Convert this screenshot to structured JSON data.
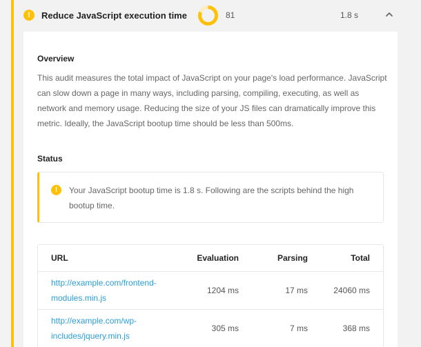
{
  "audit": {
    "title": "Reduce JavaScript execution time",
    "score": "81",
    "score_fraction": 0.81,
    "time": "1.8 s",
    "accent_color": "#ffc107",
    "warning_icon": "exclamation-icon",
    "toggle_icon": "chevron-up-icon"
  },
  "overview": {
    "heading": "Overview",
    "text": "This audit measures the total impact of JavaScript on your page's load performance. JavaScript can slow down a page in many ways, including parsing, compiling, executing, as well as network and memory usage. Reducing the size of your JS files can dramatically improve this metric. Ideally, the JavaScript bootup time should be less than 500ms."
  },
  "status": {
    "heading": "Status",
    "message": "Your JavaScript bootup time is 1.8 s. Following are the scripts behind the high bootup time."
  },
  "table": {
    "headers": {
      "url": "URL",
      "evaluation": "Evaluation",
      "parsing": "Parsing",
      "total": "Total"
    },
    "rows": [
      {
        "url_line1": "http://example.com/frontend-",
        "url_line2": "modules.min.js",
        "evaluation": "1204 ms",
        "parsing": "17 ms",
        "total": "24060 ms"
      },
      {
        "url_line1": "http://example.com/wp-",
        "url_line2": "includes/jquery.min.js",
        "evaluation": "305 ms",
        "parsing": "7 ms",
        "total": "368 ms"
      }
    ],
    "link_color": "#2a9fd6"
  }
}
